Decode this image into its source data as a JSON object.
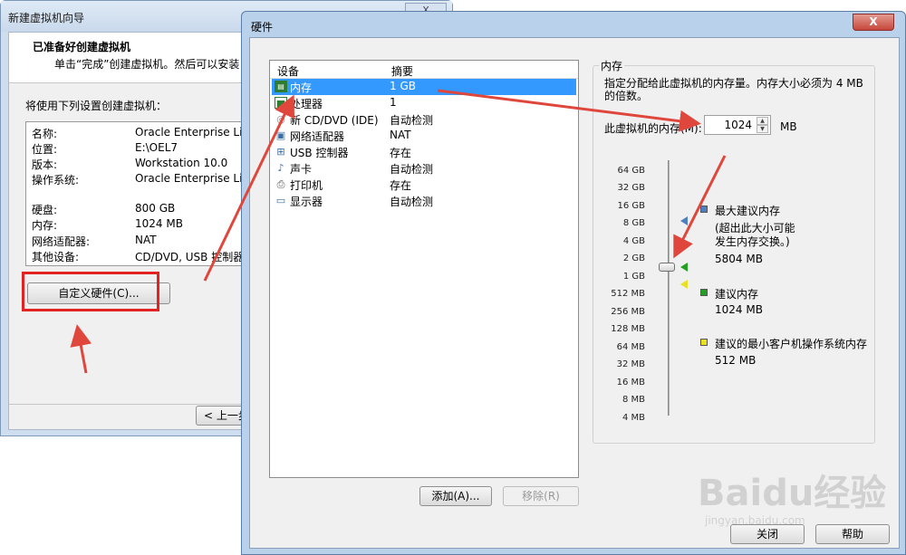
{
  "wizard": {
    "title": "新建虚拟机向导",
    "close_label": "X",
    "header_title": "已准备好创建虚拟机",
    "header_subtitle": "单击“完成”创建虚拟机。然后可以安装 C",
    "settings_label": "将使用下列设置创建虚拟机：",
    "summary": [
      {
        "key": "名称:",
        "value": "Oracle Enterprise Linux"
      },
      {
        "key": "位置:",
        "value": "E:\\OEL7"
      },
      {
        "key": "版本:",
        "value": "Workstation 10.0"
      },
      {
        "key": "操作系统:",
        "value": "Oracle Enterprise Linux"
      },
      {
        "key": "硬盘:",
        "value": "800 GB"
      },
      {
        "key": "内存:",
        "value": "1024 MB"
      },
      {
        "key": "网络适配器:",
        "value": "NAT"
      },
      {
        "key": "其他设备:",
        "value": "CD/DVD, USB 控制器, "
      }
    ],
    "customize_button": "自定义硬件(C)...",
    "back_button": "< 上一步"
  },
  "hardware": {
    "title": "硬件",
    "close_label": "X",
    "device_col": "设备",
    "summary_col": "摘要",
    "devices": [
      {
        "name": "内存",
        "summary": "1 GB",
        "icon": "memory-icon",
        "selected": true
      },
      {
        "name": "处理器",
        "summary": "1",
        "icon": "processor-icon",
        "selected": false
      },
      {
        "name": "新 CD/DVD (IDE)",
        "summary": "自动检测",
        "icon": "cd-icon",
        "selected": false
      },
      {
        "name": "网络适配器",
        "summary": "NAT",
        "icon": "network-icon",
        "selected": false
      },
      {
        "name": "USB 控制器",
        "summary": "存在",
        "icon": "usb-icon",
        "selected": false
      },
      {
        "name": "声卡",
        "summary": "自动检测",
        "icon": "sound-icon",
        "selected": false
      },
      {
        "name": "打印机",
        "summary": "存在",
        "icon": "printer-icon",
        "selected": false
      },
      {
        "name": "显示器",
        "summary": "自动检测",
        "icon": "monitor-icon",
        "selected": false
      }
    ],
    "add_button": "添加(A)...",
    "remove_button": "移除(R)",
    "close_button": "关闭",
    "help_button": "帮助",
    "memory": {
      "group_title": "内存",
      "description": "指定分配给此虚拟机的内存量。内存大小必须为 4 MB 的倍数。",
      "field_label": "此虚拟机的内存(M):",
      "value": "1024",
      "unit": "MB",
      "ticks": [
        "64 GB",
        "32 GB",
        "16 GB",
        "8 GB",
        "4 GB",
        "2 GB",
        "1 GB",
        "512 MB",
        "256 MB",
        "128 MB",
        "64 MB",
        "32 MB",
        "16 MB",
        "8 MB",
        "4 MB"
      ],
      "max_recommended_label": "最大建议内存",
      "max_recommended_note": "(超出此大小可能发生内存交换。)",
      "max_recommended_value": "5804 MB",
      "recommended_label": "建议内存",
      "recommended_value": "1024 MB",
      "min_guest_label": "建议的最小客户机操作系统内存",
      "min_guest_value": "512 MB"
    }
  },
  "watermark": {
    "text": "Baidu经验",
    "url": "jingyan.baidu.com"
  },
  "colors": {
    "annotation": "#e0473c",
    "selection": "#3399ff",
    "max_marker": "#4f7fc0",
    "rec_marker": "#22a022",
    "min_marker": "#e8e020"
  }
}
